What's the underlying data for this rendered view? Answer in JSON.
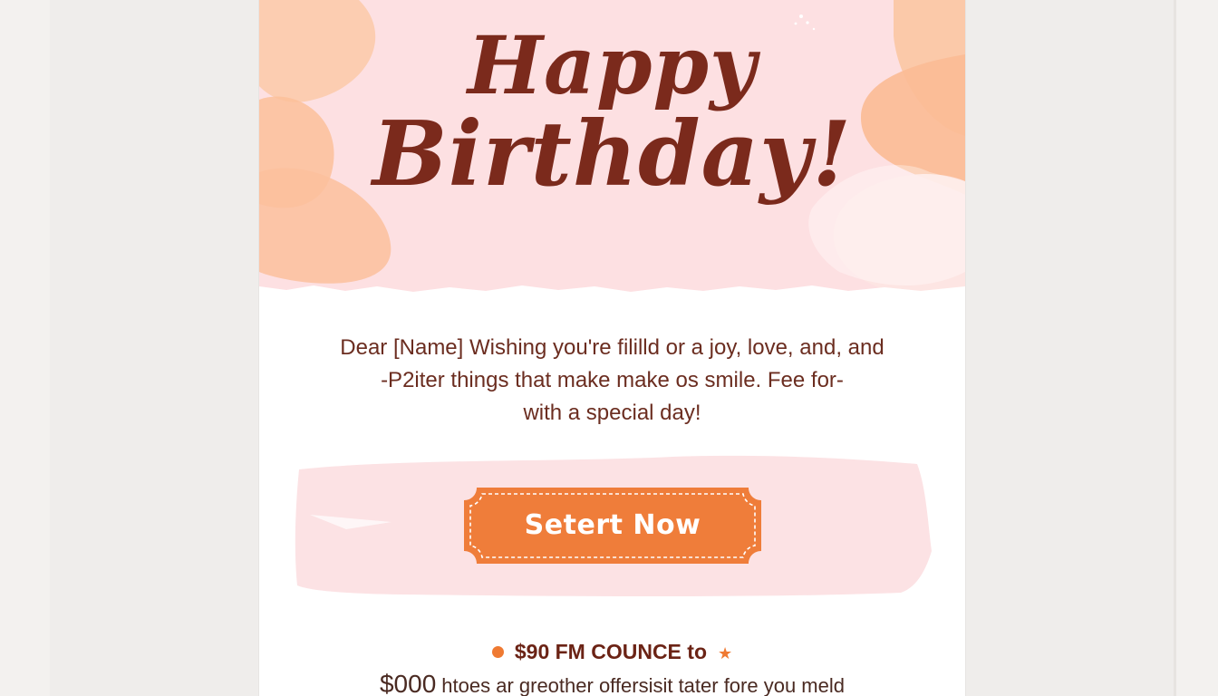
{
  "card": {
    "hero": {
      "line1": "Happy",
      "line2": "Birthday!"
    },
    "message": [
      "Dear [Name]  Wishing you're fililld or a joy, love, and, and",
      "-P2iter things that make make os smile.  Fee for-",
      "with a special day!"
    ],
    "cta": {
      "label": "Setert Now",
      "color": "#ef7d3a"
    },
    "promo": {
      "title": "$90 FM COUNCE to",
      "amount": "$000",
      "text": "htoes ar greother offersisit tater fore you meld"
    }
  },
  "colors": {
    "hero_bg": "#fde0e2",
    "hero_petals": "#fbc8a6",
    "title_text": "#7b2a1c",
    "band": "#fce2e4"
  }
}
